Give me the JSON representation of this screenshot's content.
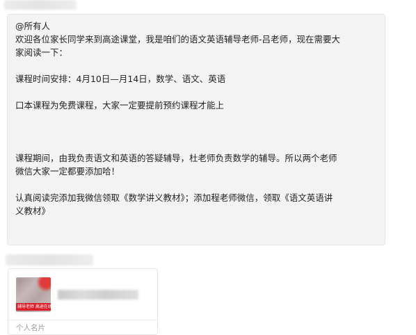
{
  "message": {
    "lines": [
      "@所有人",
      "欢迎各位家长同学来到高途课堂，我是咱们的语文英语辅导老师-吕老师，现在需要大",
      "家阅读一下：",
      "",
      "课程时间安排：4月10日—月14日，数学、语文、英语",
      "",
      "口本课程为免费课程，大家一定要提前预约课程才能上",
      "",
      "",
      "",
      " 课程期间，由我负责语文和英语的答疑辅导，杜老师负责数学的辅导。所以两个老师",
      "微信大家一定都要添加哈！",
      "",
      "认真阅读完添加我微信领取《数学讲义教材》；添加程老师微信，领取《语文英语讲",
      "义教材》"
    ]
  },
  "card": {
    "label": "个人名片",
    "avatar_band_text": "辅导老师 高途在线"
  }
}
